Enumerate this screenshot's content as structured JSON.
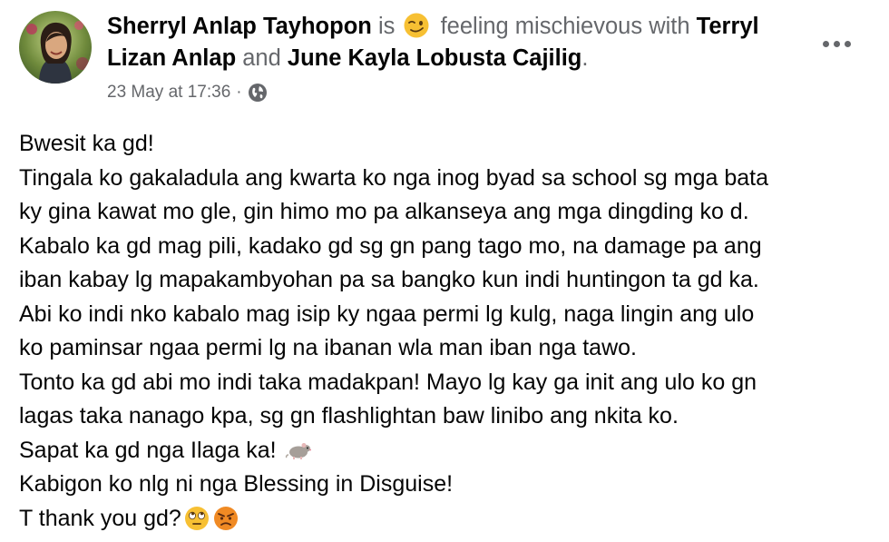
{
  "post": {
    "author": "Sherryl Anlap Tayhopon",
    "is_text": "is",
    "feeling": "feeling mischievous",
    "with_text": "with",
    "tagged_1": "Terryl Lizan Anlap",
    "and_text": "and",
    "tagged_2": "June Kayla Lobusta Cajilig",
    "period": ".",
    "timestamp": "23 May at 17:36",
    "separator": "·",
    "privacy_icon": "globe-icon",
    "more_icon": "ellipsis-icon",
    "feeling_emoji": "mischievous-face-emoji",
    "body_lines": [
      "Bwesit ka gd!",
      "Tingala ko gakaladula ang kwarta ko nga inog byad sa school sg mga bata",
      "ky gina kawat mo gle, gin himo mo pa alkanseya ang mga dingding ko d.",
      "Kabalo ka gd mag pili, kadako gd sg gn pang tago mo, na damage pa ang",
      "iban kabay lg mapakambyohan pa sa bangko kun indi huntingon ta gd ka.",
      "Abi ko indi nko kabalo mag isip ky ngaa permi lg kulg, naga lingin ang ulo",
      "ko paminsar ngaa permi lg na ibanan wla man iban nga tawo.",
      "Tonto ka gd abi mo indi taka madakpan! Mayo lg kay ga init ang ulo ko gn",
      "lagas taka nanago kpa, sg gn flashlightan baw linibo ang nkita ko.",
      "Sapat ka gd nga Ilaga ka!",
      "Kabigon ko nlg ni nga Blessing in Disguise!",
      "T thank you gd?"
    ],
    "emojis": {
      "rat": "rat-emoji",
      "eye_roll": "eye-roll-emoji",
      "angry": "angry-face-emoji"
    },
    "colors": {
      "text": "#050505",
      "muted": "#65676b",
      "emoji_yellow": "#f7c033",
      "angry_orange": "#f08a24"
    }
  }
}
